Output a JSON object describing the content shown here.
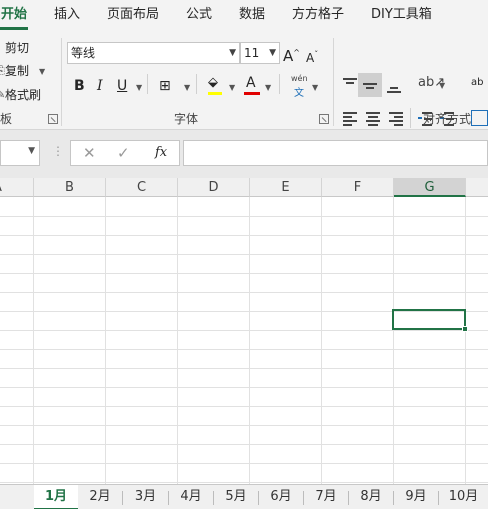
{
  "ribbon_tabs": [
    "开始",
    "插入",
    "页面布局",
    "公式",
    "数据",
    "方方格子",
    "DIY工具箱"
  ],
  "clipboard": {
    "cut_label": "剪切",
    "copy_label": "复制",
    "format_painter_label": "格式刷",
    "group_label": "板"
  },
  "font": {
    "font_name": "等线",
    "font_size": "11",
    "grow_label": "A",
    "shrink_label": "A",
    "bold_label": "B",
    "italic_label": "I",
    "underline_label": "U",
    "font_color_label": "A",
    "phonetic_top": "wén",
    "phonetic_bottom": "文",
    "group_label": "字体",
    "highlight_color": "#ffff00",
    "font_color": "#e00000"
  },
  "alignment": {
    "wrap_label": "ab",
    "group_label": "对齐方式"
  },
  "formula_bar": {
    "cancel_symbol": "✕",
    "enter_symbol": "✓",
    "fx_label": "fx",
    "name_box_value": "",
    "formula_value": ""
  },
  "columns": [
    "A",
    "B",
    "C",
    "D",
    "E",
    "F",
    "G"
  ],
  "selected_column": "G",
  "sheets": [
    "1月",
    "2月",
    "3月",
    "4月",
    "5月",
    "6月",
    "7月",
    "8月",
    "9月",
    "10月"
  ],
  "active_sheet": "1月",
  "accent_color": "#217346"
}
